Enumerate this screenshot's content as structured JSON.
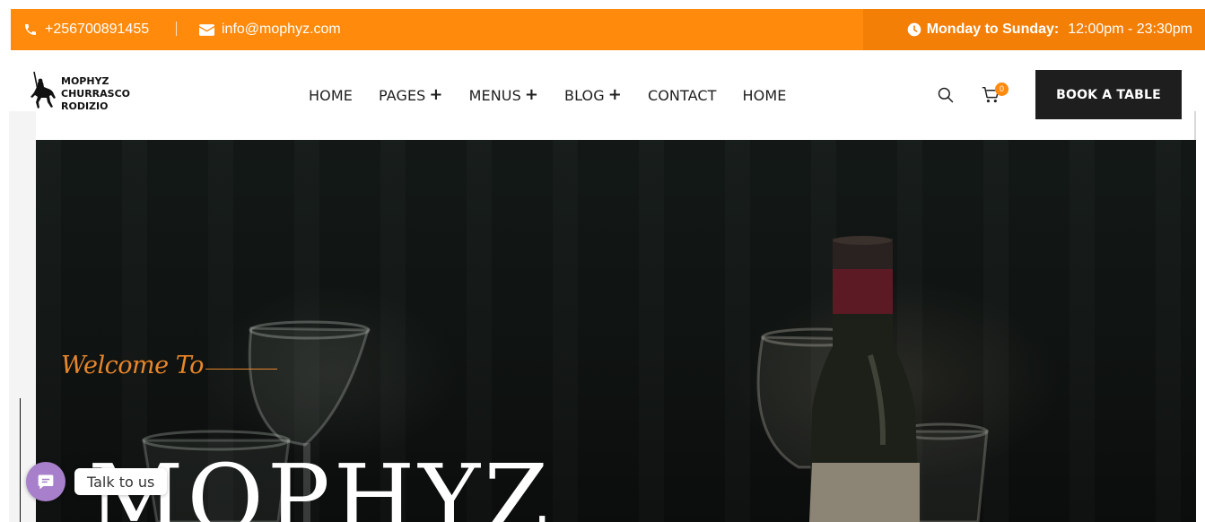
{
  "topbar": {
    "phone": "+256700891455",
    "email": "info@mophyz.com",
    "hours_label": "Monday to Sunday:",
    "hours_value": "12:00pm - 23:30pm",
    "bg_color": "#ff8a0c",
    "icons": {
      "phone": "phone-icon",
      "email": "envelope-icon",
      "clock": "clock-icon"
    }
  },
  "header": {
    "logo": {
      "line1": "MOPHYZ",
      "line2": "CHURRASCO",
      "line3": "RODIZIO",
      "icon": "horse-rider-logo"
    },
    "nav": [
      {
        "label": "HOME",
        "has_submenu": false
      },
      {
        "label": "PAGES",
        "has_submenu": true
      },
      {
        "label": "MENUS",
        "has_submenu": true
      },
      {
        "label": "BLOG",
        "has_submenu": true
      },
      {
        "label": "CONTACT",
        "has_submenu": false
      },
      {
        "label": "HOME",
        "has_submenu": false
      }
    ],
    "submenu_symbol": "+",
    "cart_count": "0",
    "book_button": "BOOK A TABLE",
    "icons": {
      "search": "search-icon",
      "cart": "cart-icon"
    }
  },
  "hero": {
    "welcome": "Welcome To",
    "title": "MOPHYZ",
    "accent_color": "#e8862a"
  },
  "chat": {
    "label": "Talk to us",
    "icon": "chat-bubble-icon",
    "color": "#a77fcb"
  }
}
